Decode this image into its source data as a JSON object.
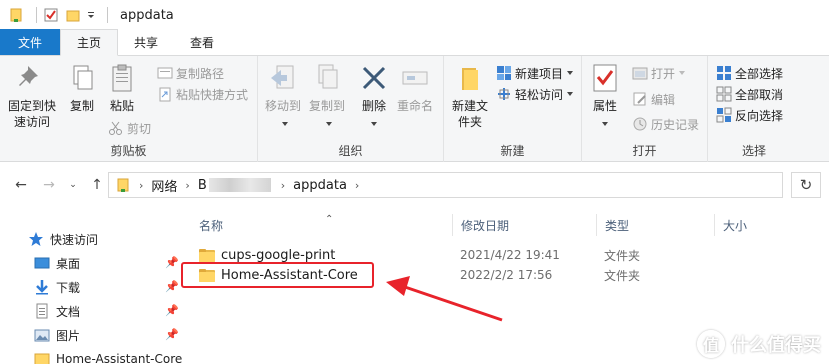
{
  "window": {
    "title": "appdata"
  },
  "tabs": [
    "文件",
    "主页",
    "共享",
    "查看"
  ],
  "ribbon": {
    "clipboard": {
      "label": "剪贴板",
      "pin_quick": "固定到快速访问",
      "copy": "复制",
      "paste": "粘贴",
      "copy_path": "复制路径",
      "paste_shortcut": "粘贴快捷方式",
      "cut": "剪切"
    },
    "organize": {
      "label": "组织",
      "move_to": "移动到",
      "copy_to": "复制到",
      "delete": "删除",
      "rename": "重命名"
    },
    "new": {
      "label": "新建",
      "new_folder": "新建文件夹",
      "new_item": "新建项目",
      "easy_access": "轻松访问"
    },
    "open": {
      "label": "打开",
      "properties": "属性",
      "open": "打开",
      "edit": "编辑",
      "history": "历史记录"
    },
    "select": {
      "label": "选择",
      "select_all": "全部选择",
      "select_none": "全部取消",
      "invert": "反向选择"
    }
  },
  "address": {
    "crumbs": [
      "网络",
      "B",
      "appdata"
    ]
  },
  "nav": {
    "quick_access": "快速访问",
    "items": [
      {
        "label": "桌面",
        "icon": "desktop-icon"
      },
      {
        "label": "下载",
        "icon": "download-icon"
      },
      {
        "label": "文档",
        "icon": "document-icon"
      },
      {
        "label": "图片",
        "icon": "picture-icon"
      },
      {
        "label": "Home-Assistant-Core",
        "icon": "folder-icon"
      }
    ]
  },
  "columns": {
    "name": "名称",
    "modified": "修改日期",
    "type": "类型",
    "size": "大小"
  },
  "files": [
    {
      "name": "cups-google-print",
      "modified": "2021/4/22 19:41",
      "type": "文件夹"
    },
    {
      "name": "Home-Assistant-Core",
      "modified": "2022/2/2 17:56",
      "type": "文件夹"
    }
  ],
  "watermark": "什么值得买",
  "colors": {
    "accent": "#1979ca",
    "annotation": "#e8232b",
    "folder": "#ffd666"
  }
}
